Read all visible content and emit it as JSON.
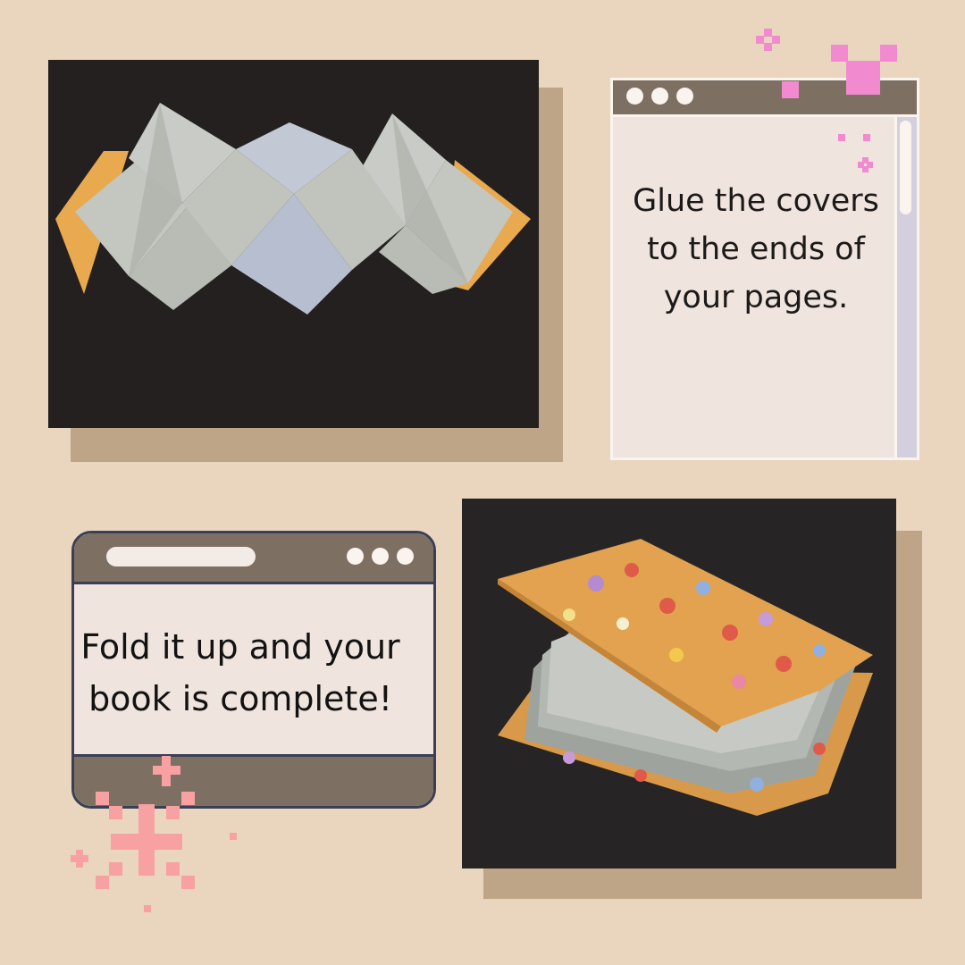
{
  "step_glue": {
    "text": "Glue the covers to the ends of your pages."
  },
  "step_fold": {
    "text_line1": "Fold it up and your",
    "text_line2": "book is complete!"
  },
  "colors": {
    "background": "#ead6bf",
    "window_bar": "#7d6f62",
    "shadow": "#bfa588",
    "sparkle_pink": "#f28ad0",
    "sparkle_salmon": "#f7a1a3"
  },
  "icons": [
    "window-dots-icon",
    "sparkle-icon"
  ]
}
